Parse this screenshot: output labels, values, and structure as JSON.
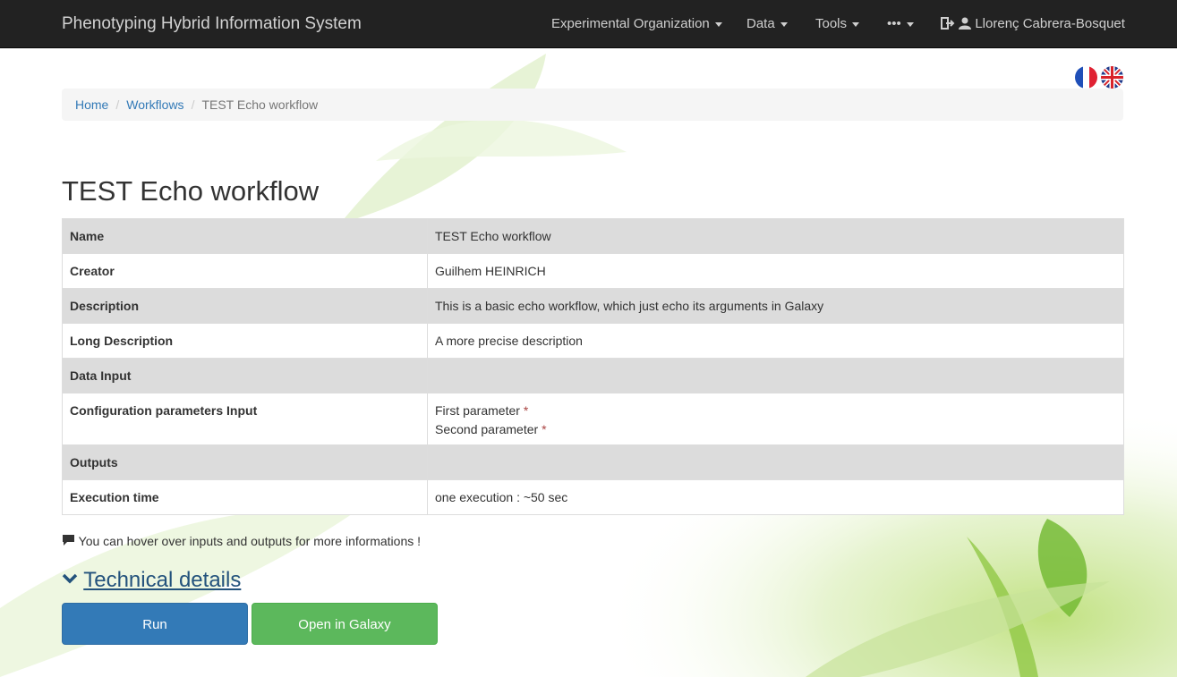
{
  "navbar": {
    "brand": "Phenotyping Hybrid Information System",
    "items": [
      {
        "label": "Experimental Organization"
      },
      {
        "label": "Data"
      },
      {
        "label": "Tools"
      },
      {
        "label": "•••"
      }
    ],
    "user": "Llorenç Cabrera-Bosquet"
  },
  "languages": [
    "fr-flag-icon",
    "uk-flag-icon"
  ],
  "breadcrumb": {
    "home": "Home",
    "workflows": "Workflows",
    "current": "TEST Echo workflow"
  },
  "page_title": "TEST Echo workflow",
  "details": {
    "name": {
      "label": "Name",
      "value": "TEST Echo workflow"
    },
    "creator": {
      "label": "Creator",
      "value": "Guilhem HEINRICH"
    },
    "description": {
      "label": "Description",
      "value": "This is a basic echo workflow, which just echo its arguments in Galaxy"
    },
    "long_description": {
      "label": "Long Description",
      "value": "A more precise description"
    },
    "data_input": {
      "label": "Data Input",
      "value": ""
    },
    "config_params": {
      "label": "Configuration parameters Input",
      "params": [
        "First parameter",
        "Second parameter"
      ],
      "required_mark": "*"
    },
    "outputs": {
      "label": "Outputs",
      "value": ""
    },
    "execution_time": {
      "label": "Execution time",
      "value": "one execution : ~50 sec"
    }
  },
  "hint": "You can hover over inputs and outputs for more informations !",
  "technical_details": "Technical details",
  "buttons": {
    "run": "Run",
    "galaxy": "Open in Galaxy"
  },
  "colors": {
    "navbar": "#222222",
    "primary": "#337ab7",
    "success": "#5cb85c",
    "link": "#337ab7"
  }
}
